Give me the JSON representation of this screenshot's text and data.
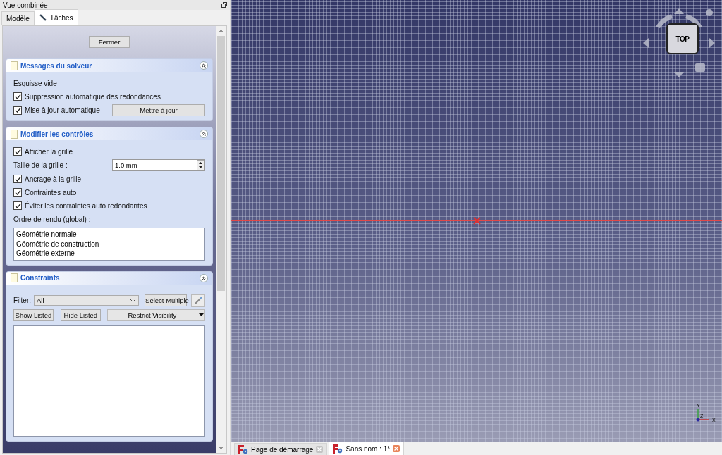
{
  "panel": {
    "title": "Vue combinée"
  },
  "tabs": [
    {
      "label": "Modèle",
      "selected": false
    },
    {
      "label": "Tâches",
      "selected": true
    }
  ],
  "close_button": "Fermer",
  "sections": [
    {
      "kind": "solver",
      "title": "Messages du solveur",
      "status": "Esquisse vide",
      "options": [
        {
          "label": "Suppression automatique des redondances",
          "checked": true
        },
        {
          "label": "Mise à jour automatique",
          "checked": true
        }
      ],
      "update_button": "Mettre à jour"
    },
    {
      "kind": "controls",
      "title": "Modifier les contrôles",
      "show_grid": {
        "label": "Afficher la grille",
        "checked": true
      },
      "grid_size_label": "Taille de la grille :",
      "grid_size_value": "1.0 mm",
      "options": [
        {
          "label": "Ancrage à la grille",
          "checked": true
        },
        {
          "label": "Contraintes auto",
          "checked": true
        },
        {
          "label": "Éviter les contraintes auto redondantes",
          "checked": true
        }
      ],
      "render_order_label": "Ordre de rendu (global) :",
      "render_order": [
        "Géométrie normale",
        "Géométrie de construction",
        "Géométrie externe"
      ]
    },
    {
      "kind": "constraints",
      "title": "Constraints",
      "filter_label": "Filter:",
      "filter_value": "All",
      "select_multiple": "Select Multiple",
      "show_listed": "Show Listed",
      "hide_listed": "Hide Listed",
      "restrict_visibility": "Restrict Visibility"
    }
  ],
  "view": {
    "cube_label": "TOP",
    "axis_labels": [
      "Y",
      "Z",
      "X"
    ]
  },
  "document_tabs": [
    {
      "label": "Page de démarrage",
      "selected": false
    },
    {
      "label": "Sans nom : 1*",
      "selected": true
    }
  ]
}
